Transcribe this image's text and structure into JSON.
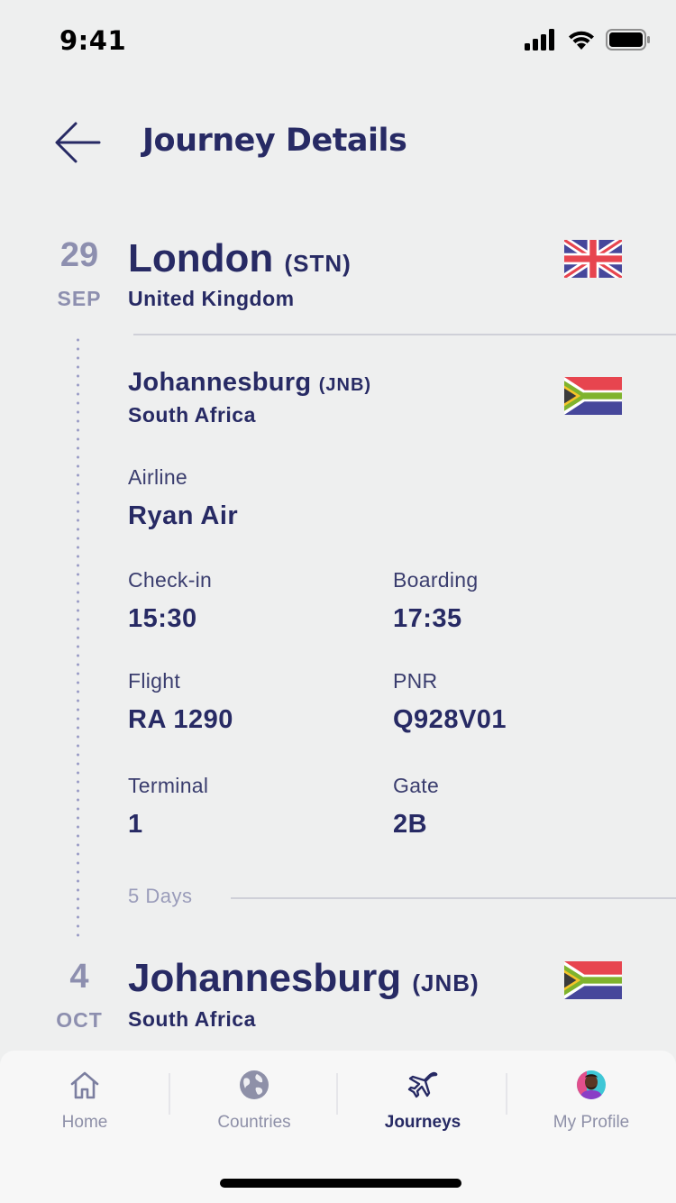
{
  "status_bar": {
    "time": "9:41"
  },
  "header": {
    "title": "Journey Details",
    "back_icon": "arrow-left-icon"
  },
  "origin": {
    "day": "29",
    "month": "SEP",
    "city": "London",
    "code": "(STN)",
    "country": "United Kingdom",
    "flag": "uk-flag-icon"
  },
  "segment": {
    "destination_city": "Johannesburg",
    "destination_code": "(JNB)",
    "destination_country": "South Africa",
    "flag": "south-africa-flag-icon",
    "airline_label": "Airline",
    "airline_value": "Ryan Air",
    "checkin_label": "Check-in",
    "checkin_value": "15:30",
    "boarding_label": "Boarding",
    "boarding_value": "17:35",
    "flight_label": "Flight",
    "flight_value": "RA 1290",
    "pnr_label": "PNR",
    "pnr_value": "Q928V01",
    "terminal_label": "Terminal",
    "terminal_value": "1",
    "gate_label": "Gate",
    "gate_value": "2B",
    "duration": "5 Days"
  },
  "destination": {
    "day": "4",
    "month": "OCT",
    "city": "Johannesburg",
    "code": "(JNB)",
    "country": "South Africa",
    "flag": "south-africa-flag-icon"
  },
  "tabs": [
    {
      "label": "Home",
      "icon": "home-icon",
      "active": false
    },
    {
      "label": "Countries",
      "icon": "globe-icon",
      "active": false
    },
    {
      "label": "Journeys",
      "icon": "airplane-icon",
      "active": true
    },
    {
      "label": "My Profile",
      "icon": "avatar",
      "active": false
    }
  ],
  "colors": {
    "primary": "#272a64",
    "muted": "#8d8faf",
    "background": "#eeefef"
  }
}
